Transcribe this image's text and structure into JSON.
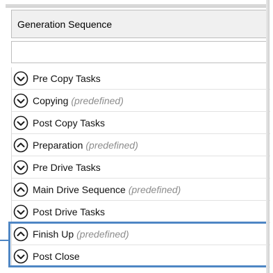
{
  "header": {
    "title": "Generation Sequence"
  },
  "filter": {
    "value": "",
    "placeholder": ""
  },
  "predefined_label": "(predefined)",
  "colors": {
    "highlight": "#4e86c4",
    "predefined_text": "#8c8c8c"
  },
  "items": [
    {
      "label": "Pre Copy Tasks",
      "predefined": false,
      "icon": "chevron-down-icon"
    },
    {
      "label": "Copying",
      "predefined": true,
      "icon": "chevron-down-icon"
    },
    {
      "label": "Post Copy Tasks",
      "predefined": false,
      "icon": "chevron-down-icon"
    },
    {
      "label": "Preparation",
      "predefined": true,
      "icon": "chevron-up-icon"
    },
    {
      "label": "Pre Drive Tasks",
      "predefined": false,
      "icon": "chevron-down-icon"
    },
    {
      "label": "Main Drive Sequence",
      "predefined": true,
      "icon": "chevron-up-icon"
    },
    {
      "label": "Post Drive Tasks",
      "predefined": false,
      "icon": "chevron-down-icon"
    },
    {
      "label": "Finish Up",
      "predefined": true,
      "icon": "chevron-up-icon"
    },
    {
      "label": "Post Close",
      "predefined": false,
      "icon": "chevron-down-icon"
    }
  ]
}
